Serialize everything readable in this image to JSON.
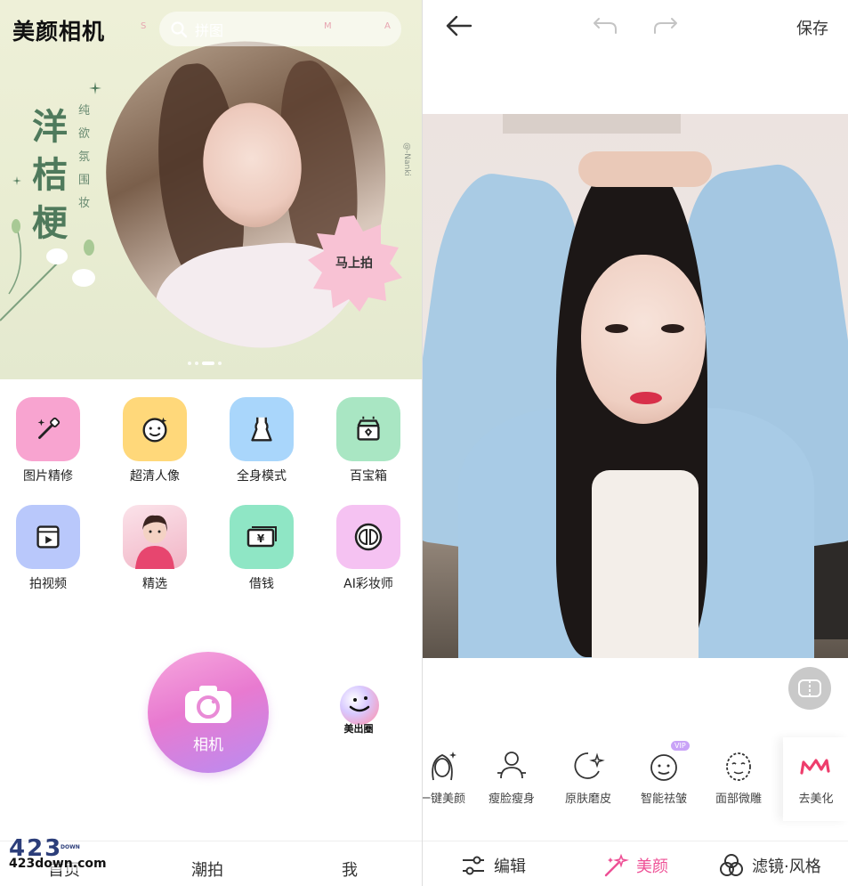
{
  "left": {
    "app_title": "美颜相机",
    "search_placeholder": "拼图",
    "deco_letters": [
      "S",
      "M",
      "A"
    ],
    "banner": {
      "big_chars": [
        "洋",
        "桔",
        "梗"
      ],
      "small_text": [
        "纯",
        "欲",
        "氛",
        "围",
        "妆"
      ],
      "credit": "@-Nanki",
      "badge": "马上拍"
    },
    "grid": [
      {
        "label": "图片精修",
        "icon": "magic-wand-icon",
        "color": "#f8a4d0"
      },
      {
        "label": "超清人像",
        "icon": "face-icon",
        "color": "#ffd87a"
      },
      {
        "label": "全身模式",
        "icon": "dress-icon",
        "color": "#a9d6fb"
      },
      {
        "label": "百宝箱",
        "icon": "treasure-box-icon",
        "color": "#a9e6c3"
      },
      {
        "label": "拍视频",
        "icon": "video-icon",
        "color": "#b9c8fb"
      },
      {
        "label": "精选",
        "icon": "featured-photo-icon",
        "color": "#f5c4d4"
      },
      {
        "label": "借钱",
        "icon": "money-icon",
        "color": "#8fe6c5"
      },
      {
        "label": "AI彩妆师",
        "icon": "makeup-icon",
        "color": "#f5c2f2"
      }
    ],
    "camera_label": "相机",
    "meichu_label": "美出圈",
    "tabs": [
      "首页",
      "潮拍",
      "我"
    ],
    "watermark": {
      "num": "423",
      "down": "DOWN",
      "site": "423down.com"
    }
  },
  "right": {
    "save_label": "保存",
    "tools": [
      {
        "label": "一键美颜",
        "icon": "one-click-beauty-icon"
      },
      {
        "label": "瘦脸瘦身",
        "icon": "slim-face-icon"
      },
      {
        "label": "原肤磨皮",
        "icon": "skin-smooth-icon"
      },
      {
        "label": "智能祛皱",
        "icon": "wrinkle-remove-icon",
        "badge": "VIP"
      },
      {
        "label": "面部微雕",
        "icon": "face-sculpt-icon"
      },
      {
        "label": "去美化",
        "icon": "meitu-logo-icon"
      }
    ],
    "tabs": [
      {
        "label": "编辑",
        "icon": "sliders-icon"
      },
      {
        "label": "美颜",
        "icon": "magic-wand-icon",
        "active": true
      },
      {
        "label": "滤镜·风格",
        "icon": "filter-icon"
      }
    ],
    "accent": "#ee4f95"
  }
}
